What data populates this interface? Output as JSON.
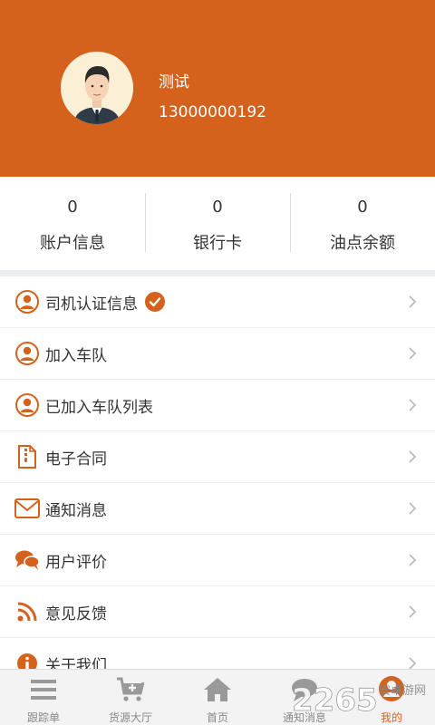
{
  "profile": {
    "name": "测试",
    "phone": "13000000192"
  },
  "stats": [
    {
      "value": "0",
      "label": "账户信息"
    },
    {
      "value": "0",
      "label": "银行卡"
    },
    {
      "value": "0",
      "label": "油点余额"
    }
  ],
  "menu": [
    {
      "label": "司机认证信息",
      "icon": "user-circle-icon",
      "verified": true
    },
    {
      "label": "加入车队",
      "icon": "user-circle-icon"
    },
    {
      "label": "已加入车队列表",
      "icon": "user-circle-icon"
    },
    {
      "label": "电子合同",
      "icon": "contract-document-icon"
    },
    {
      "label": "通知消息",
      "icon": "envelope-icon"
    },
    {
      "label": "用户评价",
      "icon": "chat-bubbles-icon"
    },
    {
      "label": "意见反馈",
      "icon": "rss-feed-icon"
    },
    {
      "label": "关于我们",
      "icon": "info-icon"
    }
  ],
  "tabbar": {
    "active": "我的",
    "tabs": [
      {
        "label": "跟踪单",
        "icon": "list-icon"
      },
      {
        "label": "货源大厅",
        "icon": "cart-plus-icon"
      },
      {
        "label": "首页",
        "icon": "home-icon"
      },
      {
        "label": "通知消息",
        "icon": "chat-icon"
      },
      {
        "label": "我的",
        "icon": "user-icon"
      }
    ]
  },
  "watermark": {
    "text": "2265",
    "sub": "安卓游网"
  },
  "colors": {
    "accent": "#D4611C",
    "header_bg": "#D4611C",
    "separator": "#E9EEF0",
    "tab_inactive": "#888888",
    "tabbar_bg": "#F3F3F3"
  }
}
